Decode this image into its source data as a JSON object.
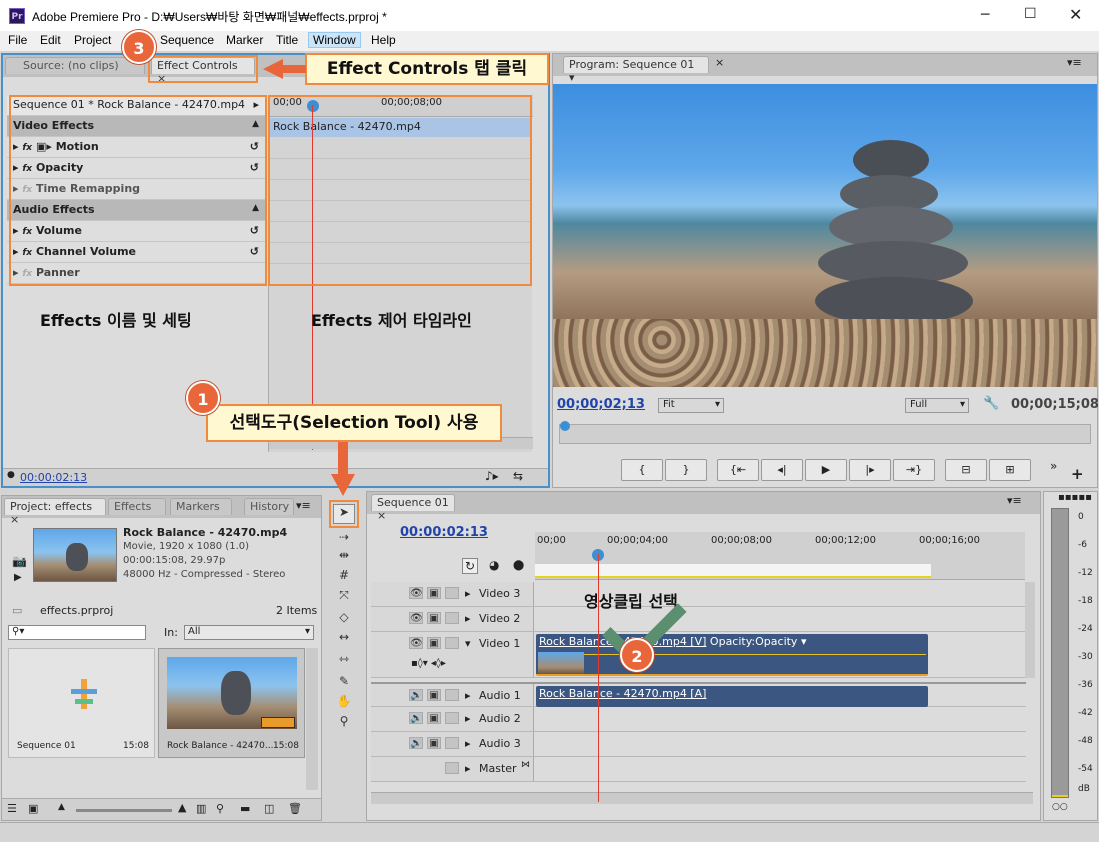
{
  "window": {
    "title": "Adobe Premiere Pro - D:₩Users₩바탕 화면₩패널₩effects.prproj *",
    "icon": "Pr"
  },
  "menu": [
    "File",
    "Edit",
    "Project",
    "Sequence",
    "Marker",
    "Title",
    "Window",
    "Help"
  ],
  "source_panel": {
    "tab_source": "Source: (no clips)",
    "tab_effect_controls": "Effect Controls",
    "close": "×"
  },
  "effect_controls": {
    "header": "Sequence 01 * Rock Balance - 42470.mp4",
    "sections": [
      {
        "label": "Video Effects",
        "items": [
          "Motion",
          "Opacity",
          "Time Remapping"
        ]
      },
      {
        "label": "Audio Effects",
        "items": [
          "Volume",
          "Channel Volume",
          "Panner"
        ]
      }
    ],
    "ruler": {
      "start": "00;00",
      "mid": "00;00;08;00"
    },
    "clip": "Rock Balance - 42470.mp4",
    "timecode": "00:00:02:13"
  },
  "annotations": {
    "ec_tab_callout": "Effect Controls 탭 클릭",
    "name_settings": "Effects 이름 및 세팅",
    "ctrl_timeline": "Effects 제어 타임라인",
    "selection_tool": "선택도구(Selection Tool) 사용",
    "select_clip": "영상클립 선택",
    "step1": "1",
    "step2": "2",
    "step3": "3"
  },
  "program": {
    "tab": "Program: Sequence 01",
    "timecode_left": "00;00;02;13",
    "fit": "Fit",
    "full": "Full",
    "timecode_right": "00;00;15;08"
  },
  "project": {
    "tabs": [
      "Project: effects",
      "Effects",
      "Markers",
      "History"
    ],
    "clip_name": "Rock Balance - 42470.mp4",
    "meta": [
      "Movie, 1920 x 1080 (1.0)",
      "00:00:15:08, 29.97p",
      "48000 Hz - Compressed - Stereo"
    ],
    "file": "effects.prproj",
    "count": "2 Items",
    "in_label": "In:",
    "in_value": "All",
    "bins": [
      {
        "name": "Sequence 01",
        "dur": "15:08"
      },
      {
        "name": "Rock Balance - 42470...",
        "dur": "15:08"
      }
    ]
  },
  "timeline": {
    "tab": "Sequence 01",
    "timecode": "00:00:02:13",
    "ruler": [
      "00;00",
      "00;00;04;00",
      "00;00;08;00",
      "00;00;12;00",
      "00;00;16;00"
    ],
    "tracks": [
      "Video 3",
      "Video 2",
      "Video 1",
      "Audio 1",
      "Audio 2",
      "Audio 3",
      "Master"
    ],
    "video_clip": "Rock Balance - 42470.mp4 [V]",
    "opacity": "Opacity:Opacity ▾",
    "audio_clip": "Rock Balance - 42470.mp4 [A]"
  },
  "meter": {
    "labels": [
      "0",
      "-6",
      "-12",
      "-18",
      "-24",
      "-30",
      "-36",
      "-42",
      "-48",
      "-54"
    ],
    "unit": "dB"
  },
  "colors": {
    "accent": "#f08a3e",
    "clip": "#3b5680",
    "timecode": "#2244aa",
    "playhead": "#e23a2a"
  }
}
